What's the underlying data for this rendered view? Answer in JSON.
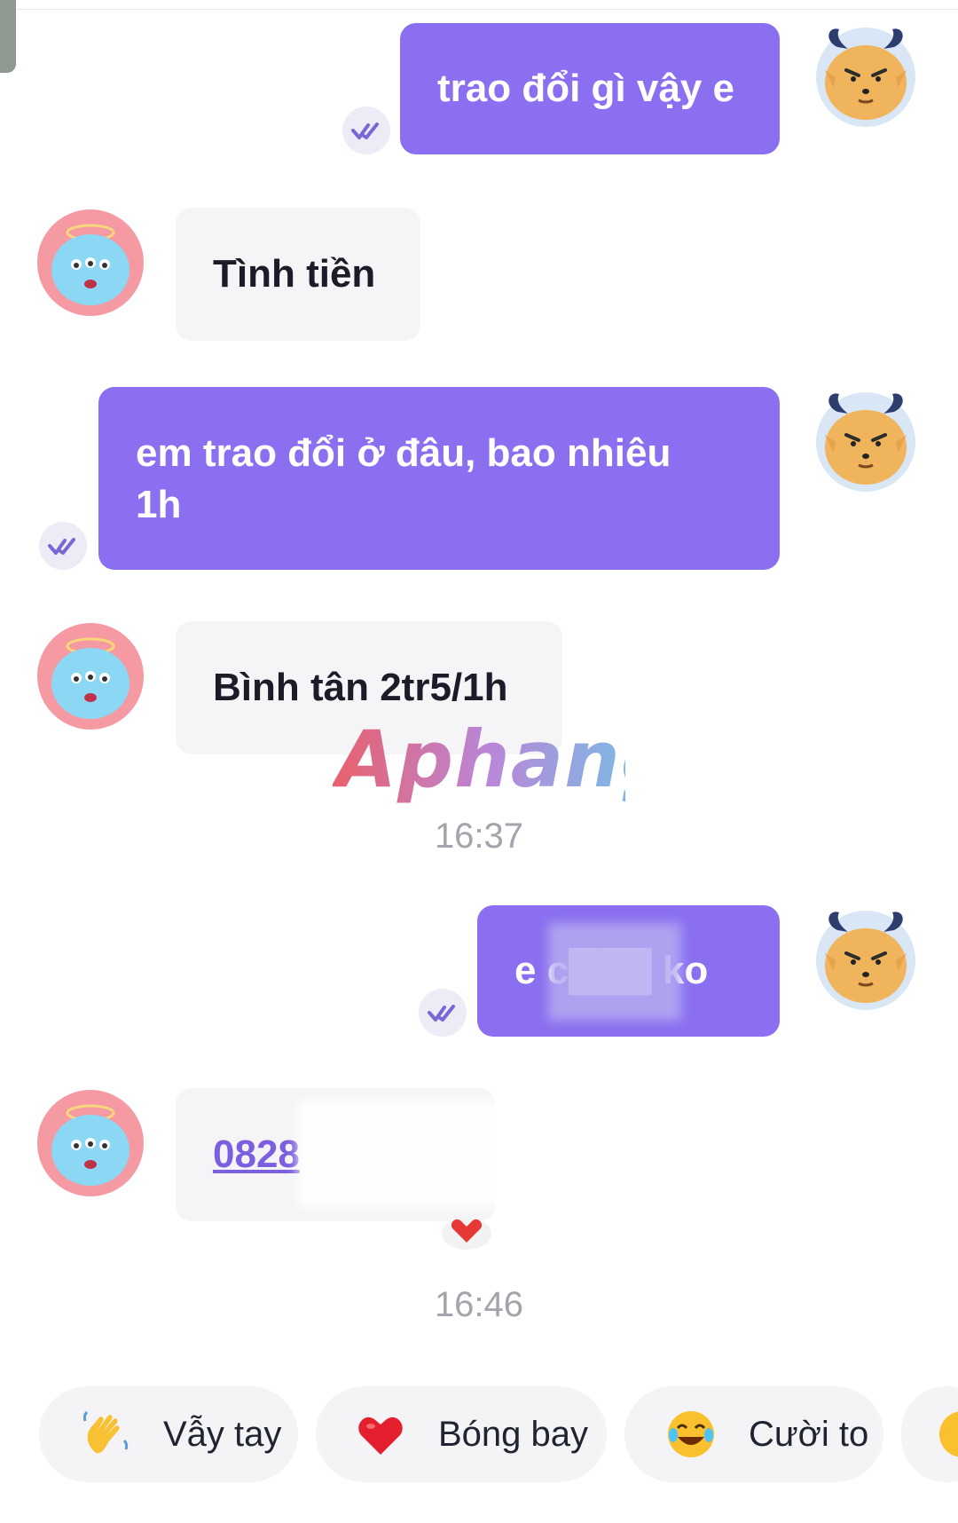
{
  "messages": [
    {
      "side": "out",
      "text": "trao đổi gì vậy e"
    },
    {
      "side": "in",
      "text": "Tình tiền"
    },
    {
      "side": "out",
      "text": "em trao đổi ở đâu, bao nhiêu 1h"
    },
    {
      "side": "in",
      "text": "Bình tân 2tr5/1h"
    },
    {
      "side": "out",
      "text": "e c███ ko"
    },
    {
      "side": "in",
      "text": "0828"
    }
  ],
  "timestamps": [
    "16:37",
    "16:46"
  ],
  "watermark": "Aphang",
  "quick_reactions": [
    {
      "icon": "waving-hand-icon",
      "label": "Vẫy tay"
    },
    {
      "icon": "heart-icon",
      "label": "Bóng bay"
    },
    {
      "icon": "laughing-face-icon",
      "label": "Cười to"
    }
  ],
  "colors": {
    "outgoing_bubble": "#8b6ff0",
    "incoming_bubble": "#f5f5f8",
    "timestamp": "#a4a4ac",
    "link": "#7b5fe0"
  }
}
